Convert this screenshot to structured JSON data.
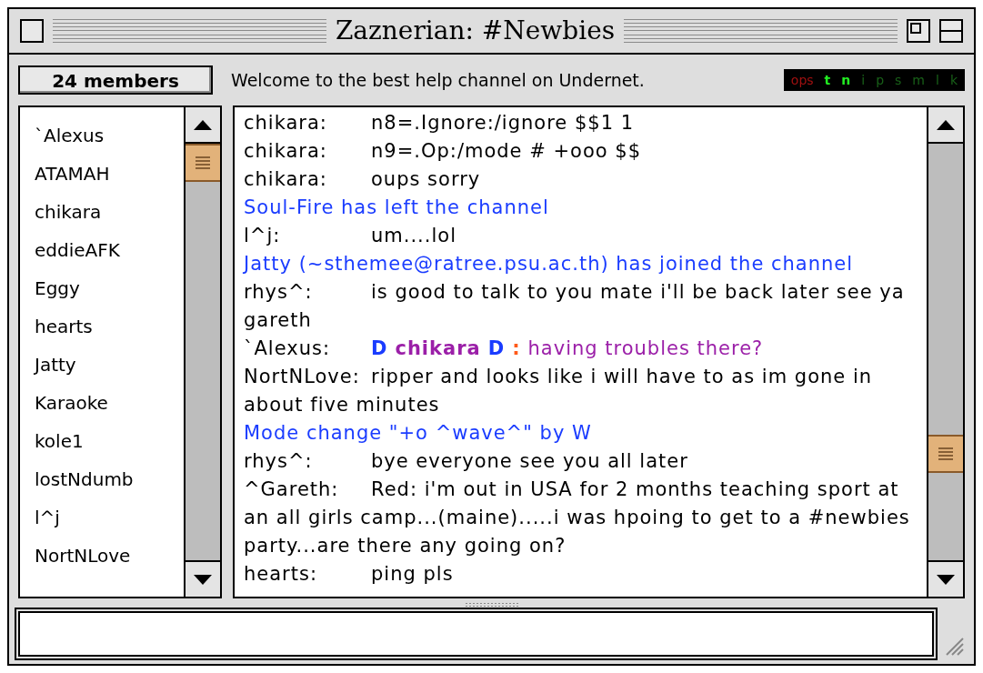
{
  "window": {
    "title": "Zaznerian: #Newbies"
  },
  "toolbar": {
    "members_button": "24 members",
    "topic": "Welcome to the best help channel on Undernet.",
    "modes": {
      "ops": "ops",
      "flags": [
        {
          "label": "t",
          "on": true
        },
        {
          "label": "n",
          "on": true
        },
        {
          "label": "i",
          "on": false
        },
        {
          "label": "p",
          "on": false
        },
        {
          "label": "s",
          "on": false
        },
        {
          "label": "m",
          "on": false
        },
        {
          "label": "l",
          "on": false
        },
        {
          "label": "k",
          "on": false
        }
      ]
    }
  },
  "members": [
    "`Alexus",
    "ATAMAH",
    "chikara",
    "eddieAFK",
    "Eggy",
    "hearts",
    "Jatty",
    "Karaoke",
    "kole1",
    "lostNdumb",
    "l^j",
    "NortNLove"
  ],
  "messages": [
    {
      "kind": "message",
      "nick": "chikara:",
      "text": "n8=.Ignore:/ignore $$1 1"
    },
    {
      "kind": "message",
      "nick": "chikara:",
      "text": "n9=.Op:/mode # +ooo $$"
    },
    {
      "kind": "message",
      "nick": "chikara:",
      "text": "oups sorry"
    },
    {
      "kind": "event",
      "text": "Soul-Fire has left the channel"
    },
    {
      "kind": "message",
      "nick": "l^j:",
      "text": "um....lol"
    },
    {
      "kind": "event",
      "text": "Jatty (~sthemee@ratree.psu.ac.th) has joined the channel"
    },
    {
      "kind": "message",
      "nick": "rhys^:",
      "text": "is good to talk to you mate i'll be back later see ya gareth"
    },
    {
      "kind": "styled",
      "nick": "`Alexus:",
      "segments": [
        {
          "text": "D",
          "color": "#1a3cff",
          "bold": true
        },
        {
          "text": "chikara",
          "color": "#9b1fa8",
          "bold": true
        },
        {
          "text": "D",
          "color": "#1a3cff",
          "bold": true
        },
        {
          "text": ":",
          "color": "#ff5a1a",
          "bold": true
        },
        {
          "text": "having troubles there?",
          "color": "#9b1fa8",
          "bold": false
        }
      ]
    },
    {
      "kind": "message",
      "nick": "NortNLove:",
      "text": "ripper and looks like i will have to as im gone in about five minutes"
    },
    {
      "kind": "event",
      "text": "Mode change \"+o ^wave^\" by W"
    },
    {
      "kind": "message",
      "nick": "rhys^:",
      "text": "bye everyone see you all later"
    },
    {
      "kind": "message",
      "nick": "^Gareth:",
      "text": "Red: i'm out in USA for 2 months teaching sport at an all girls camp...(maine).....i was hpoing to get to a #newbies party...are there any going on?"
    },
    {
      "kind": "message",
      "nick": "hearts:",
      "text": "ping pls"
    }
  ]
}
